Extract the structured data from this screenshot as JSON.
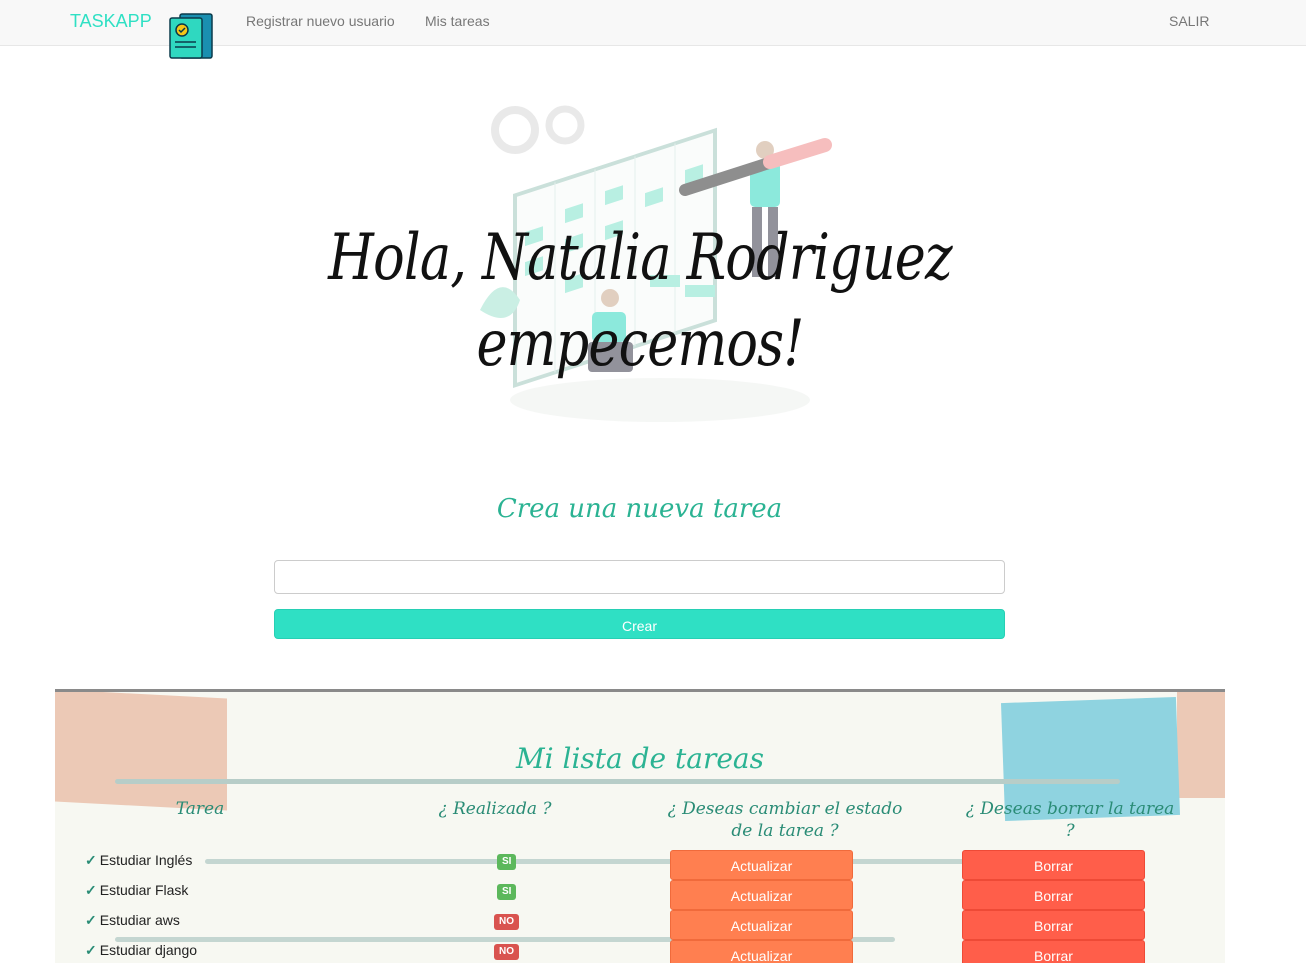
{
  "navbar": {
    "brand": "TASKAPP",
    "logo_icon": "task-document-icon",
    "links": {
      "register": "Registrar nuevo usuario",
      "tasks": "Mis tareas",
      "logout": "SALIR"
    }
  },
  "hero": {
    "greeting_line1": "Hola, Natalia Rodriguez",
    "greeting_line2": "empecemos!",
    "illustration": "kanban-board-illustration"
  },
  "create_form": {
    "title": "Crea una nueva tarea",
    "input_value": "",
    "button_label": "Crear"
  },
  "task_list": {
    "title": "Mi lista de tareas",
    "headers": {
      "task": "Tarea",
      "done": "¿ Realizada ?",
      "change": "¿ Deseas cambiar el estado de la tarea ?",
      "delete": "¿ Deseas borrar la tarea ?"
    },
    "rows": [
      {
        "name": "Estudiar Inglés",
        "status": "SI",
        "update_label": "Actualizar",
        "delete_label": "Borrar"
      },
      {
        "name": "Estudiar Flask",
        "status": "SI",
        "update_label": "Actualizar",
        "delete_label": "Borrar"
      },
      {
        "name": "Estudiar aws",
        "status": "NO",
        "update_label": "Actualizar",
        "delete_label": "Borrar"
      },
      {
        "name": "Estudiar django",
        "status": "NO",
        "update_label": "Actualizar",
        "delete_label": "Borrar"
      }
    ]
  },
  "colors": {
    "brand": "#2fe0c4",
    "heading": "#2bb393",
    "update_button": "#ff7f50",
    "delete_button": "#ff5e4a",
    "badge_yes": "#5cb85c",
    "badge_no": "#d9534f"
  }
}
